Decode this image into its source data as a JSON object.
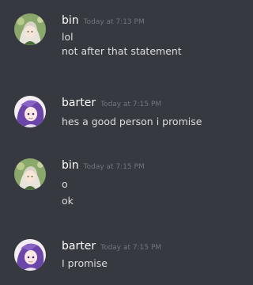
{
  "messages": [
    {
      "author": "bin",
      "timestamp": "Today at 7:13 PM",
      "avatar_icon": "anime-girl-avatar-icon",
      "lines": [
        "lol",
        "not after that statement"
      ]
    },
    {
      "author": "barter",
      "timestamp": "Today at 7:15 PM",
      "avatar_icon": "anime-girl-purple-hair-avatar-icon",
      "lines": [
        "hes a good person i promise"
      ]
    },
    {
      "author": "bin",
      "timestamp": "Today at 7:15 PM",
      "avatar_icon": "anime-girl-avatar-icon",
      "lines": [
        "o",
        "ok"
      ]
    },
    {
      "author": "barter",
      "timestamp": "Today at 7:15 PM",
      "avatar_icon": "anime-girl-purple-hair-avatar-icon",
      "lines": [
        "I promise"
      ]
    }
  ],
  "colors": {
    "background": "#36393f",
    "username": "#ffffff",
    "message_text": "#dcddde",
    "timestamp": "#72767d"
  }
}
